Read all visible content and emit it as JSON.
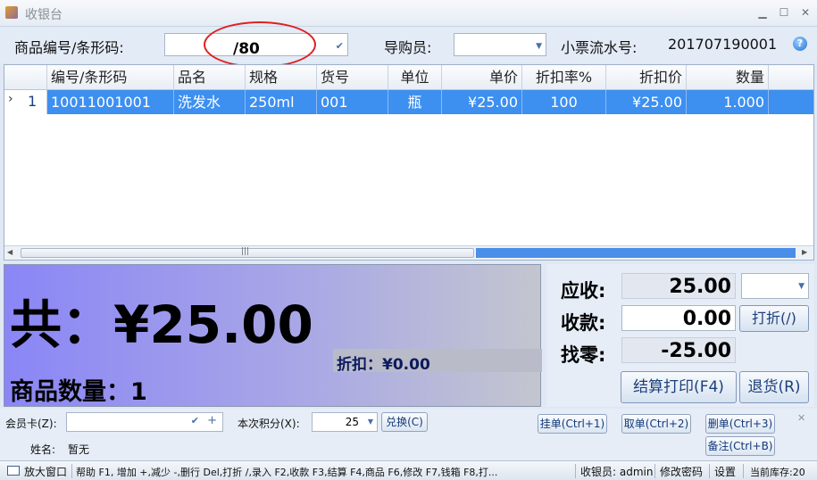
{
  "window": {
    "title": "收银台",
    "min": "▁",
    "max": "☐",
    "close": "✕"
  },
  "header": {
    "barcode_label": "商品编号/条形码:",
    "barcode_value": "/80",
    "guide_label": "导购员:",
    "guide_value": "",
    "receipt_label": "小票流水号:",
    "receipt_value": "201707190001",
    "help": "?"
  },
  "grid": {
    "columns": [
      "编号/条形码",
      "品名",
      "规格",
      "货号",
      "单位",
      "单价",
      "折扣率%",
      "折扣价",
      "数量"
    ],
    "rows": [
      {
        "index": "1",
        "indicator": "›",
        "code": "10011001001",
        "name": "洗发水",
        "spec": "250ml",
        "item_no": "001",
        "unit": "瓶",
        "price": "¥25.00",
        "discount_rate": "100",
        "discount_price": "¥25.00",
        "qty": "1.000"
      }
    ],
    "scroll_grip": "|||"
  },
  "summary": {
    "total": "共：¥25.00",
    "quantity": "商品数量：1",
    "discount": "折扣：¥0.00"
  },
  "payment": {
    "due_label": "应收:",
    "due_value": "25.00",
    "paid_label": "收款:",
    "paid_value": "0.00",
    "change_label": "找零:",
    "change_value": "-25.00",
    "discount_button": "打折(/)",
    "checkout_button": "结算打印(F4)",
    "return_button": "退货(R)"
  },
  "member": {
    "card_label": "会员卡(Z):",
    "card_value": "",
    "points_label": "本次积分(X):",
    "points_value": "25",
    "redeem_button": "兑换(C)",
    "name_label": "姓名:",
    "name_value": "暂无",
    "hold_button": "挂单(Ctrl+1)",
    "retrieve_button": "取单(Ctrl+2)",
    "delete_button": "删单(Ctrl+3)",
    "note_button": "备注(Ctrl+B)"
  },
  "status": {
    "enlarge": "放大窗口",
    "help_text": "帮助 F1, 增加 +,减少 -,删行 Del,打折 /,录入 F2,收款 F3,结算 F4,商品 F6,修改 F7,钱箱 F8,打...",
    "cashier": "收银员: admin",
    "change_pwd": "修改密码",
    "settings": "设置",
    "stock": "当前库存:20"
  }
}
